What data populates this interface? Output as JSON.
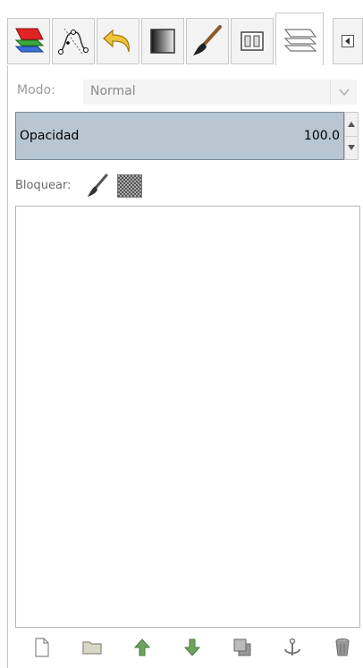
{
  "tabs": [
    {
      "name": "Capas",
      "icon": "layers-stack-icon"
    },
    {
      "name": "Rutas",
      "icon": "paths-icon"
    },
    {
      "name": "Deshacer",
      "icon": "undo-icon"
    },
    {
      "name": "Degradados",
      "icon": "gradient-icon"
    },
    {
      "name": "Pinceles",
      "icon": "paintbrush-icon"
    },
    {
      "name": "Dispositivos",
      "icon": "device-status-icon"
    },
    {
      "name": "Capas",
      "icon": "layers-icon",
      "active": true
    }
  ],
  "mode": {
    "label": "Modo:",
    "value": "Normal"
  },
  "opacity": {
    "label": "Opacidad",
    "value": "100.0",
    "percent": 100
  },
  "lock": {
    "label": "Bloquear:"
  },
  "bottom_buttons": [
    {
      "name": "new-layer",
      "icon": "new-document-icon"
    },
    {
      "name": "new-layer-group",
      "icon": "folder-icon"
    },
    {
      "name": "raise-layer",
      "icon": "arrow-up-icon"
    },
    {
      "name": "lower-layer",
      "icon": "arrow-down-icon"
    },
    {
      "name": "duplicate-layer",
      "icon": "duplicate-icon"
    },
    {
      "name": "anchor-layer",
      "icon": "anchor-icon"
    },
    {
      "name": "delete-layer",
      "icon": "trash-icon"
    }
  ],
  "colors": {
    "opacity_fill": "#b8c6d1",
    "icon_green": "#6fa45f",
    "panel_border": "#c8c8c8"
  }
}
